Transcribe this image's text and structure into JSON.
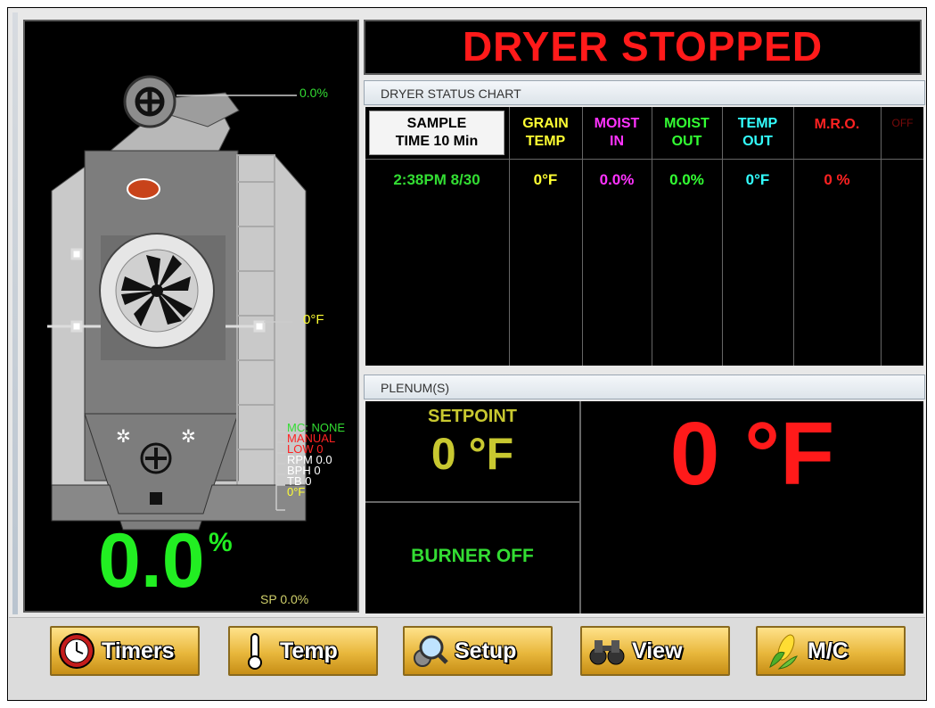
{
  "title": "DRYER STOPPED",
  "dryer_panel": {
    "top_fan_pct": "0.0%",
    "mid_temp": "0°F",
    "status_lines": [
      {
        "text": "MC: NONE",
        "color": "#33dd33"
      },
      {
        "text": "MANUAL",
        "color": "#ff2222"
      },
      {
        "text": "LOW 0",
        "color": "#ff2222"
      },
      {
        "text": "RPM 0.0",
        "color": "#ffffff"
      },
      {
        "text": "BPH 0",
        "color": "#ffffff"
      },
      {
        "text": "TB 0",
        "color": "#ffffff"
      },
      {
        "text": "0°F",
        "color": "#ffff33"
      }
    ],
    "moisture_value": "0.0",
    "moisture_unit": "%",
    "setpoint": "SP 0.0%"
  },
  "status_chart": {
    "header": "DRYER STATUS CHART",
    "columns": [
      {
        "line1": "SAMPLE",
        "line2": "TIME 10 Min",
        "color": "#000000"
      },
      {
        "line1": "GRAIN",
        "line2": "TEMP",
        "color": "#ffff33"
      },
      {
        "line1": "MOIST",
        "line2": "IN",
        "color": "#ff33ff"
      },
      {
        "line1": "MOIST",
        "line2": "OUT",
        "color": "#33ff33"
      },
      {
        "line1": "TEMP",
        "line2": "OUT",
        "color": "#33ffff"
      },
      {
        "line1": "M.R.O.",
        "line2": "",
        "color": "#ff2222"
      },
      {
        "line1": "OFF",
        "line2": "",
        "color": "#6a0000"
      }
    ],
    "rows": [
      {
        "time": "2:38PM 8/30",
        "grain_temp": "0°F",
        "moist_in": "0.0%",
        "moist_out": "0.0%",
        "temp_out": "0°F",
        "mro": "0 %"
      }
    ]
  },
  "plenum": {
    "header": "PLENUM(S)",
    "setpoint_label": "SETPOINT",
    "setpoint_value": "0 °F",
    "burner_status": "BURNER OFF",
    "current_temp": "0 °F"
  },
  "buttons": [
    {
      "label": "Timers",
      "icon": "clock-icon"
    },
    {
      "label": "Temp",
      "icon": "thermometer-icon"
    },
    {
      "label": "Setup",
      "icon": "magnifier-gear-icon"
    },
    {
      "label": "View",
      "icon": "binoculars-icon"
    },
    {
      "label": "M/C",
      "icon": "corn-icon"
    }
  ]
}
